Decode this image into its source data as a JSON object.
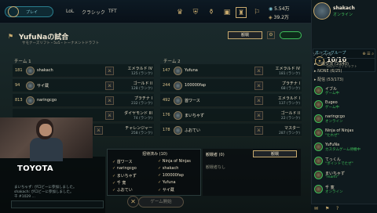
{
  "nav": {
    "play_label": "プレイ",
    "links": [
      "LoL",
      "クラシック",
      "TFT"
    ],
    "currency": {
      "be": "5.54万",
      "rp": "39.2万"
    }
  },
  "profile": {
    "name": "shakach",
    "status": "オンライン"
  },
  "group": {
    "title": "オープングループ",
    "count": "10/10",
    "sub": "LoLシーズナルラフト"
  },
  "social": {
    "tools_label": "ソーシャル",
    "categories": [
      "▸ 一般交流 (10/40)",
      "▸ NONE (6/25)",
      "▸ 配信 (53/173)"
    ],
    "friends": [
      {
        "name": "イブル",
        "status": "ゲーム中"
      },
      {
        "name": "Eugeo",
        "status": "ゲーム中"
      },
      {
        "name": "naringcgo",
        "status": "オンライン"
      },
      {
        "name": "Ninja of Ninjas",
        "status": "\"たれぜ\""
      },
      {
        "name": "YuFuNa",
        "status": "カスタムゲーム待機中"
      },
      {
        "name": "てっくん",
        "status": "\"ポイントでたぜ\""
      },
      {
        "name": "まいちゃず",
        "status": "\"mami\""
      },
      {
        "name": "千 寛",
        "status": "オンライン"
      }
    ]
  },
  "lobby": {
    "title": "YufuNaの試合",
    "subtitle": "サモナーズリフト・5v5・トーナメントドラフト",
    "join_label": "観戦"
  },
  "teams": {
    "team1_label": "チーム 1",
    "team2_label": "チーム 2",
    "team1": [
      {
        "num": "181",
        "name": "shakach",
        "rank": "エメラルド IV",
        "lp": "125 (ランク)"
      },
      {
        "num": "94",
        "name": "サイ蔵",
        "rank": "ゴールド II",
        "lp": "128 (ランク)"
      },
      {
        "num": "813",
        "name": "naringcgo",
        "rank": "プラチナ I",
        "lp": "232 (ランク)"
      },
      {
        "num": "",
        "name": "",
        "rank": "ダイヤモンド III",
        "lp": "74 (ランク)"
      },
      {
        "num": "",
        "name": "",
        "rank": "チャレンジャー",
        "lp": "258 (ランク)"
      }
    ],
    "team2": [
      {
        "num": "147",
        "name": "Yufuna",
        "rank": "エメラルド IV",
        "lp": "181 (ランク)"
      },
      {
        "num": "244",
        "name": "100000fap",
        "rank": "プラチナ I",
        "lp": "68 (ランク)"
      },
      {
        "num": "492",
        "name": "首ワース",
        "rank": "エメラルド I",
        "lp": "137 (ランク)"
      },
      {
        "num": "176",
        "name": "まいちゃず",
        "rank": "ゴールド II",
        "lp": "22 (ランク)"
      },
      {
        "num": "178",
        "name": "ふおてい",
        "rank": "マスター",
        "lp": "287 (ランク)"
      }
    ]
  },
  "bans": {
    "title": "招待済み (10)",
    "left": [
      "首ワース",
      "naringcgo",
      "まいちゃず",
      "千 寛",
      "ふおてい"
    ],
    "right": [
      "Ninja of Ninjas",
      "shakach",
      "100000fap",
      "Yufuna",
      "サイ蔵"
    ]
  },
  "side": {
    "title": "観戦者 (0)",
    "button": "観戦",
    "empty": "観戦者なし"
  },
  "start": {
    "label": "ゲーム開始"
  },
  "chat": {
    "lines": [
      "まいちゃず: がロビーに参加しました。",
      "shakach: がロビーに参加しました。",
      "千 #1029 ... "
    ]
  },
  "webcam": {
    "caption": "TOYOTA"
  }
}
